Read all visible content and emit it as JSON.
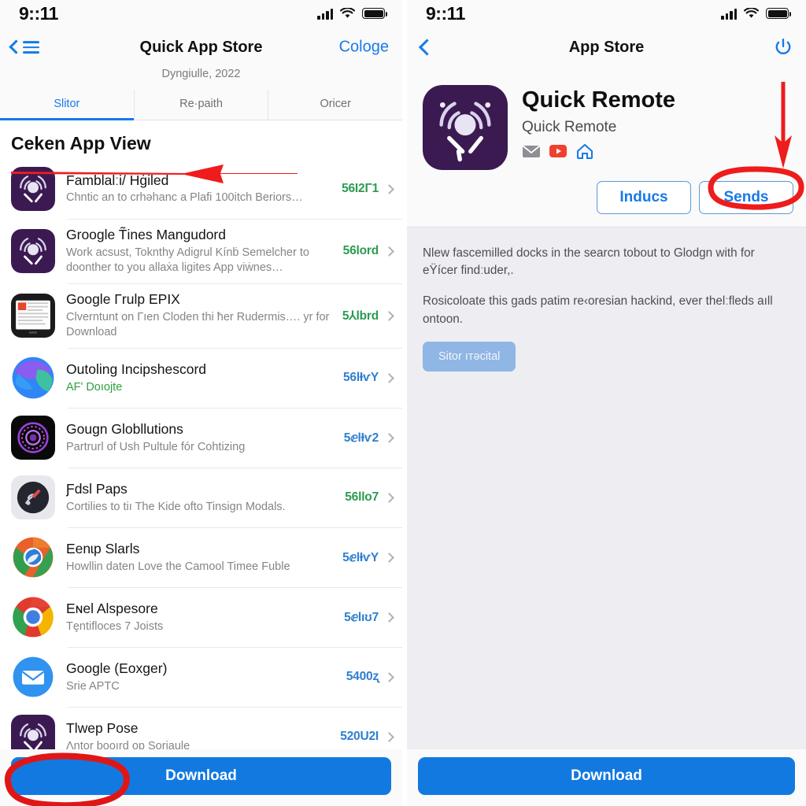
{
  "colors": {
    "accent_blue": "#1779e8",
    "download_blue": "#1279e0",
    "price_green": "#2b9b50",
    "price_blue": "#2f7fd0",
    "annotation_red": "#ee1c1c",
    "panel_bg": "#ffffff",
    "detail_bg": "#eeeef2"
  },
  "left": {
    "status": {
      "time": "9::11",
      "signal_icon": "signal-bars-icon",
      "wifi_icon": "wifi-icon",
      "battery_icon": "battery-icon"
    },
    "nav": {
      "back_icon": "chevron-left-icon",
      "menu_icon": "hamburger-menu-icon",
      "title": "Quick App Store",
      "right_action": "Cologe",
      "subtitle": "Dyngiulle, 2022"
    },
    "tabs": [
      {
        "label": "Slitor",
        "active": true
      },
      {
        "label": "Re·paith",
        "active": false
      },
      {
        "label": "Oricer",
        "active": false
      }
    ],
    "section_heading": "Ceken App View",
    "apps": [
      {
        "icon": "quick-remote-icon",
        "title": "Famblalːi/ Hġiled",
        "desc": "Chntic an to crhəhanc a Plafi 100itch Beriors…",
        "value": "56I2Γ1",
        "value_color": "green",
        "desc_green": false
      },
      {
        "icon": "quick-remote-icon",
        "title": "Groogle T̃ines Mangudord",
        "desc": "Work acsust, Toknthy Adigrul Kínḃ Semelcher to doonther to you allaẋa ligites App viẇnes…",
        "value": "56lord",
        "value_color": "green",
        "desc_green": false
      },
      {
        "icon": "tablet-news-icon",
        "title": "Google Γrulp EPIX",
        "desc": "Clverntunt on Γıen Cloden thi ħer Rudermis…. yr for Download",
        "value": "5⅄lbrd",
        "value_color": "green",
        "desc_green": false
      },
      {
        "icon": "outlook-globe-icon",
        "title": "Outoling Incipshescord",
        "desc": "AFʹ Doıojte",
        "value": "56lƗѵY",
        "value_color": "blue",
        "desc_green": true
      },
      {
        "icon": "purple-ring-icon",
        "title": "Gougn Globllutions",
        "desc": "Partrurl of Ush Pultule fór Cohtizing",
        "value": "5ⅇlƗѵ2",
        "value_color": "blue",
        "desc_green": false
      },
      {
        "icon": "dark-tool-icon",
        "title": "Ƒdsl Paps",
        "desc": "Cortilies to tiı The Kide ofto Tinsign Modals.",
        "value": "56llo7",
        "value_color": "green",
        "desc_green": false
      },
      {
        "icon": "chrome-blue-icon",
        "title": "Eenɩp Slarls",
        "desc": "Howllin daten Love the Camool Timee Fuble",
        "value": "5ⅇlƗѵY",
        "value_color": "blue",
        "desc_green": false
      },
      {
        "icon": "chrome-icon",
        "title": "Eɴel Alspesore",
        "desc": "Tȩntifloces 7 Joists",
        "value": "5ⅇlıʊ7",
        "value_color": "blue",
        "desc_green": false
      },
      {
        "icon": "mail-icon",
        "title": "Google (Eoxger)",
        "desc": "Srie APTC",
        "value": "5400ʐ",
        "value_color": "blue",
        "desc_green": false
      },
      {
        "icon": "quick-remote-icon",
        "title": "Тlwep Pose",
        "desc": "Ʌntor booırd op Soriaule",
        "value": "520U2I",
        "value_color": "blue",
        "desc_green": false
      }
    ],
    "download_button": "Download"
  },
  "right": {
    "status": {
      "time": "9::11",
      "signal_icon": "signal-bars-icon",
      "wifi_icon": "wifi-icon",
      "battery_icon": "battery-icon"
    },
    "nav": {
      "back_icon": "chevron-left-icon",
      "title": "App Store",
      "power_icon": "power-icon"
    },
    "hero": {
      "icon": "quick-remote-icon",
      "name": "Quick Remote",
      "subtitle": "Quick Remote",
      "badges": [
        "mail-badge-icon",
        "youtube-badge-icon",
        "home-badge-icon"
      ]
    },
    "actions": [
      {
        "label": "Inducs",
        "highlighted": false
      },
      {
        "label": "Sends",
        "highlighted": true
      }
    ],
    "paragraphs": [
      "Nlew fascemilled docks in the searcn tobout to Glodɡn with for eŸícer findːuder,.",
      "Rosicoloate this gads patim re‹oresian hackind, ever thelːfleds aıll ontoon."
    ],
    "ghost_button": "Sitor ıтəсital",
    "download_button": "Download"
  },
  "annotations": {
    "left_heading_arrow": "red-left-arrow-underline",
    "left_download_circle": "red-ellipse-highlight",
    "right_down_arrow": "red-down-arrow",
    "right_sends_circle": "red-ellipse-highlight"
  }
}
